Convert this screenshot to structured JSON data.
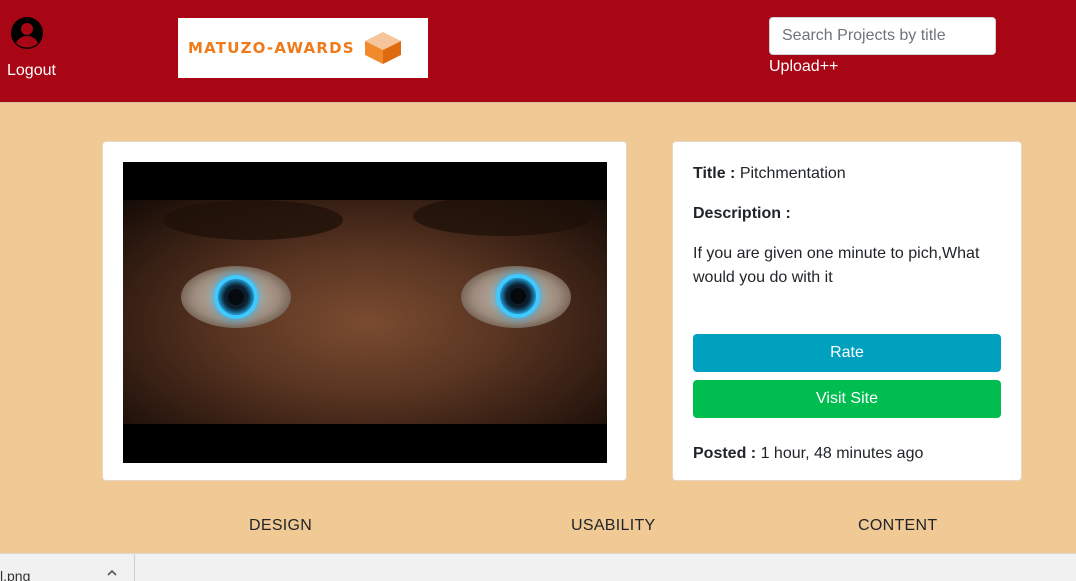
{
  "header": {
    "logout_label": "Logout",
    "logo_text": "MATUZO-AWARDS",
    "search_placeholder": "Search Projects by title",
    "upload_label": "Upload++",
    "icons": {
      "user": "user-circle-icon",
      "logo": "cube-icon"
    }
  },
  "project": {
    "title_label": "Title :",
    "title": "Pitchmentation",
    "description_label": "Description :",
    "description": "If you are given one minute to pich,What would you do with it",
    "rate_label": "Rate",
    "visit_label": "Visit Site",
    "posted_label": "Posted :",
    "posted": "1 hour, 48 minutes ago"
  },
  "metrics": [
    "DESIGN",
    "USABILITY",
    "CONTENT"
  ],
  "download_bar": {
    "file_name": "l.png"
  },
  "colors": {
    "navbar": "#a90615",
    "page_background": "#f0c995",
    "rate_button": "#00a0bf",
    "visit_button": "#00bd50",
    "logo_orange": "#ef7a1a"
  }
}
